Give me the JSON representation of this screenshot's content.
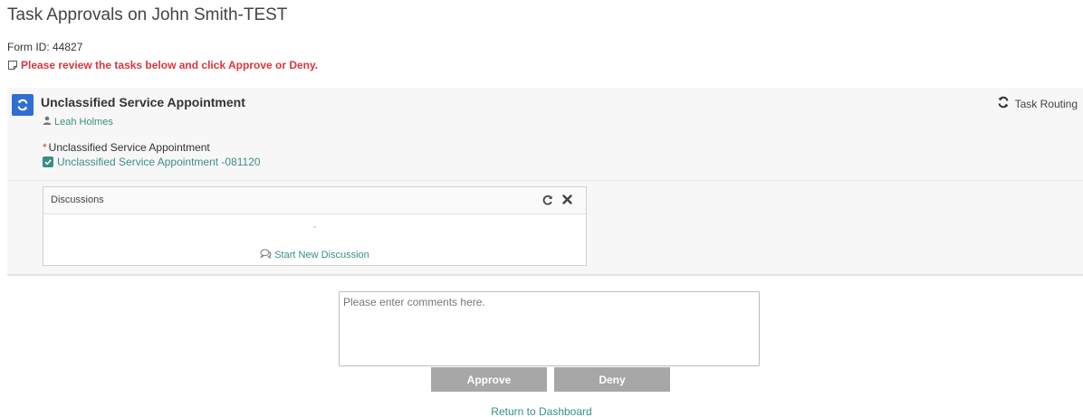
{
  "page": {
    "title": "Task Approvals on John Smith-TEST",
    "form_id": "Form ID: 44827",
    "instruction": "Please review the tasks below and click Approve or Deny."
  },
  "task": {
    "title": "Unclassified Service Appointment",
    "routing_label": "Task Routing",
    "assignee": "Leah Holmes",
    "field_required_marker": "*",
    "field_label": "Unclassified Service Appointment",
    "field_value": "Unclassified Service Appointment -081120"
  },
  "discussions": {
    "title": "Discussions",
    "empty": "-",
    "start_label": "Start New Discussion"
  },
  "comments": {
    "placeholder": "Please enter comments here."
  },
  "actions": {
    "approve_label": "Approve",
    "deny_label": "Deny",
    "return_label": "Return to Dashboard"
  },
  "colors": {
    "accent_link": "#3a8f82",
    "instruction_red": "#d9363e",
    "task_icon_blue": "#2f6fd1",
    "button_gray": "#a7a7a7"
  },
  "icons": {
    "instruction": "note-icon",
    "task_type": "refresh-icon",
    "routing": "refresh-icon",
    "assignee": "user-icon",
    "field_value": "checkbox-checked-icon",
    "discussions_refresh": "refresh-icon",
    "discussions_close": "close-icon",
    "start_discussion": "comments-icon"
  }
}
